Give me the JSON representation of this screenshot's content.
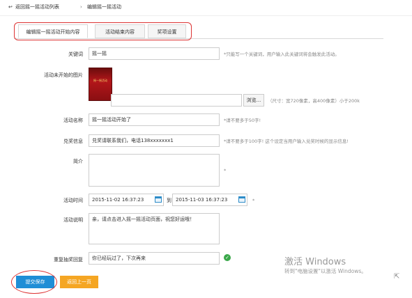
{
  "breadcrumb": {
    "back_icon": "back-arrow-icon",
    "back_label": "返回摇一摇活动列表",
    "separator": "›",
    "current": "编辑摇一摇活动"
  },
  "tabs": [
    {
      "label": "编辑摇一摇活动开始内容",
      "active": true
    },
    {
      "label": "活动结束内容",
      "active": false
    },
    {
      "label": "奖项设置",
      "active": false
    }
  ],
  "form": {
    "keyword": {
      "label": "关键词",
      "value": "摇一摇",
      "hint": "*只能写一个关键词，用户输入此关键词将会触发此活动。"
    },
    "image": {
      "label": "活动未开始的图片",
      "poster_text": "摇一摇活动",
      "path_value": "",
      "browse_label": "浏览...",
      "hint": "（尺寸：宽720像素，高400像素）小于200k"
    },
    "name": {
      "label": "活动名称",
      "value": "摇一摇活动开始了",
      "hint": "*请不要多于50字!"
    },
    "exchange": {
      "label": "兑奖信息",
      "value": "兑奖请联系我们，电话138xxxxxxx1",
      "hint": "*请不要多于100字! 这个设定当用户输入兑奖时候的显示信息!"
    },
    "intro": {
      "label": "简介",
      "value": "",
      "hint": "*"
    },
    "time": {
      "label": "活动时间",
      "start": "2015-11-02 16:37:23",
      "to_label": "到",
      "end": "2015-11-03 16:37:23",
      "hint": "*"
    },
    "desc": {
      "label": "活动说明",
      "value": "亲，请点击进入摇一摇活动页面，祝您好运哦！"
    },
    "repeat": {
      "label": "重复抽奖回复",
      "value": "你已经玩过了，下次再来",
      "status_icon": "check-circle-icon"
    }
  },
  "actions": {
    "submit_label": "提交保存",
    "back_label": "返回上一页"
  },
  "watermark": {
    "title": "激活 Windows",
    "subtitle": "转到\"电脑设置\"以激活 Windows。"
  },
  "colors": {
    "primary": "#1f8ed6",
    "secondary": "#f5a623",
    "highlight": "#dd3333",
    "success": "#3aa84a"
  }
}
